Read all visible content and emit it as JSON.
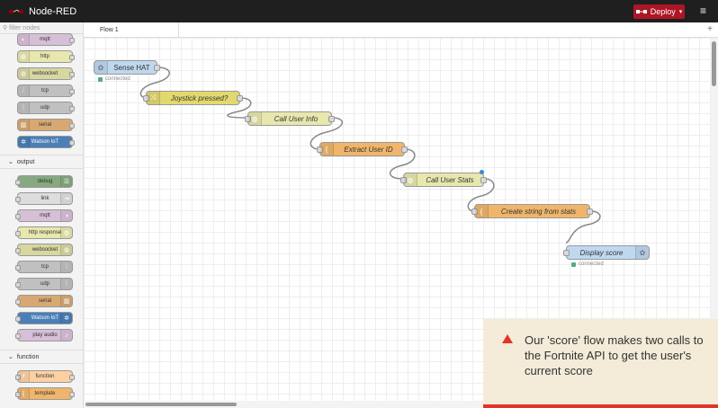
{
  "app": {
    "title": "Node-RED",
    "deploy_label": "Deploy"
  },
  "palette": {
    "filter_placeholder": "filter nodes",
    "top_items": [
      {
        "label": "mqtt",
        "color": "#d8bfd8"
      },
      {
        "label": "http",
        "color": "#e7e7ae"
      },
      {
        "label": "websocket",
        "color": "#d7d7a0"
      },
      {
        "label": "tcp",
        "color": "#c0c0c0"
      },
      {
        "label": "udp",
        "color": "#c0c0c0"
      },
      {
        "label": "serial",
        "color": "#d8a872"
      },
      {
        "label": "Watson IoT",
        "color": "#4a7fb7"
      }
    ],
    "output_label": "output",
    "output_items": [
      {
        "label": "debug",
        "color": "#87a980"
      },
      {
        "label": "link",
        "color": "#dddddd"
      },
      {
        "label": "mqtt",
        "color": "#d8bfd8"
      },
      {
        "label": "http response",
        "color": "#e7e7ae"
      },
      {
        "label": "websocket",
        "color": "#d7d7a0"
      },
      {
        "label": "tcp",
        "color": "#c0c0c0"
      },
      {
        "label": "udp",
        "color": "#c0c0c0"
      },
      {
        "label": "serial",
        "color": "#d8a872"
      },
      {
        "label": "Watson IoT",
        "color": "#4a7fb7"
      },
      {
        "label": "play audio",
        "color": "#d8bfd8"
      }
    ],
    "function_label": "function",
    "function_items": [
      {
        "label": "function",
        "color": "#fdd0a2"
      },
      {
        "label": "template",
        "color": "#f0b56b"
      }
    ]
  },
  "workspace": {
    "tab_label": "Flow 1",
    "nodes": {
      "sense_hat": {
        "label": "Sense HAT",
        "status": "connected",
        "color": "#c0d8ef"
      },
      "joystick": {
        "label": "Joystick pressed?",
        "color": "#e2d96e"
      },
      "user_info": {
        "label": "Call User Info",
        "color": "#e7e7ae"
      },
      "extract": {
        "label": "Extract User ID",
        "color": "#f0b56b"
      },
      "stats": {
        "label": "Call User Stats",
        "color": "#e7e7ae"
      },
      "create": {
        "label": "Create string from stats",
        "color": "#f0b56b"
      },
      "display": {
        "label": "Display score",
        "status": "connected",
        "color": "#c0d8ef"
      }
    }
  },
  "caption": {
    "text": "Our 'score' flow makes two calls to the Fortnite API to get the user's current score"
  }
}
